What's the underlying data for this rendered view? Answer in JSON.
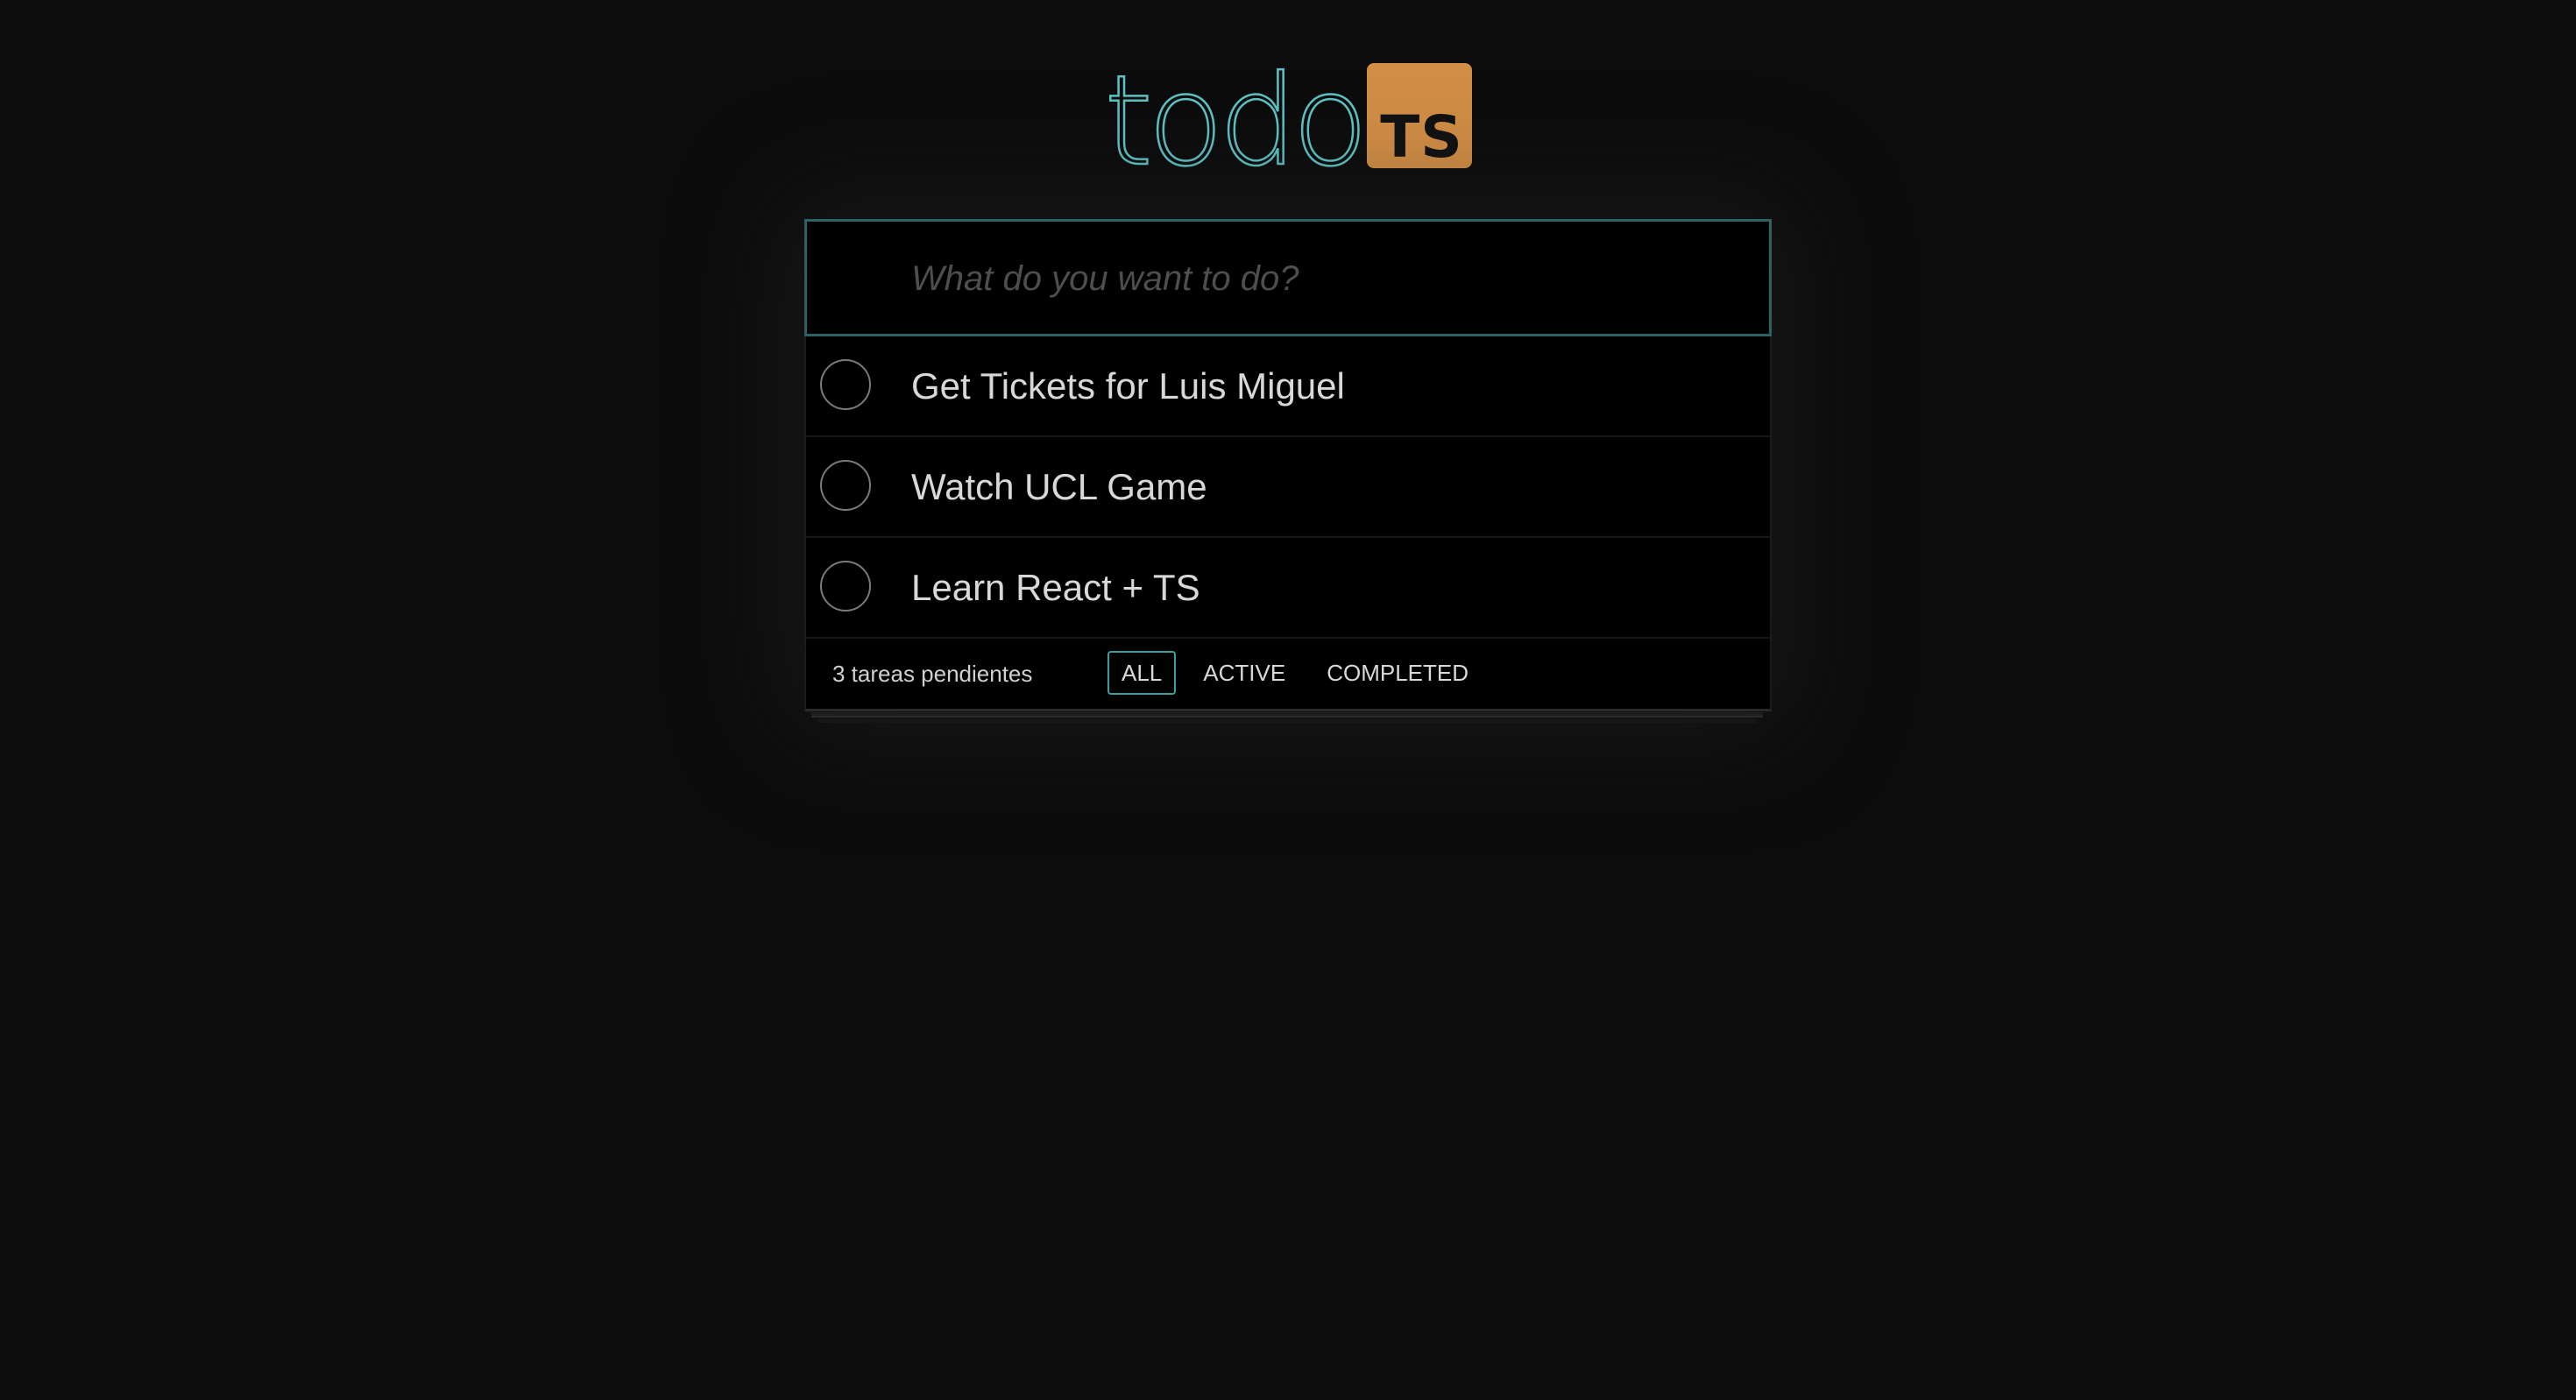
{
  "header": {
    "logo_text": "todo",
    "logo_badge": "TS"
  },
  "new_todo": {
    "placeholder": "What do you want to do?",
    "value": ""
  },
  "todos": [
    {
      "title": "Get Tickets for Luis Miguel",
      "completed": false
    },
    {
      "title": "Watch UCL Game",
      "completed": false
    },
    {
      "title": "Learn React + TS",
      "completed": false
    }
  ],
  "footer": {
    "count_text": "3 tareas pendientes",
    "filters": [
      {
        "label": "ALL",
        "selected": true
      },
      {
        "label": "ACTIVE",
        "selected": false
      },
      {
        "label": "COMPLETED",
        "selected": false
      }
    ]
  },
  "colors": {
    "background": "#0c0c0c",
    "accent": "#5fc3c5",
    "badge": "#d28e45"
  }
}
